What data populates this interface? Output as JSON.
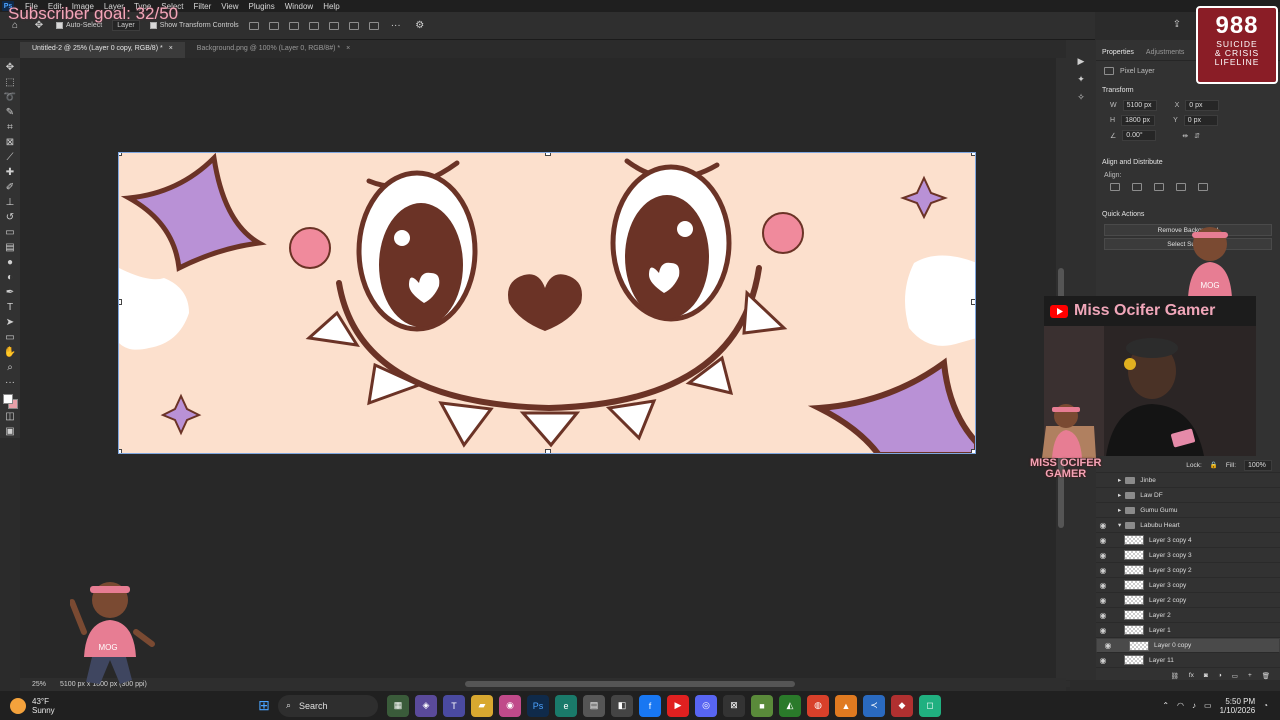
{
  "overlay": {
    "subscriber_goal": "Subscriber goal: 32/50",
    "hotline": {
      "number": "988",
      "line1": "SUICIDE",
      "line2": "& CRISIS",
      "line3": "LIFELINE"
    },
    "stream_title": "Miss Ocifer Gamer",
    "brand_line1": "MISS OCIFER",
    "brand_line2": "GAMER",
    "brand_badge": "MOG"
  },
  "menubar": {
    "app_icon": "Ps",
    "items": [
      "File",
      "Edit",
      "Image",
      "Layer",
      "Type",
      "Select",
      "Filter",
      "View",
      "Plugins",
      "Window",
      "Help"
    ]
  },
  "options": {
    "auto_select_label": "Auto-Select",
    "auto_select_value": "Layer",
    "transform_controls_label": "Show Transform Controls"
  },
  "tabs": [
    {
      "label": "Untitled-2 @ 25% (Layer 0 copy, RGB/8) *",
      "active": true
    },
    {
      "label": "Background.png @ 100% (Layer 0, RGB/8#) *",
      "active": false
    }
  ],
  "properties": {
    "tab_properties": "Properties",
    "tab_adjustments": "Adjustments",
    "layer_type": "Pixel Layer",
    "transform_title": "Transform",
    "w_label": "W",
    "w_value": "5100 px",
    "h_label": "H",
    "h_value": "1800 px",
    "x_label": "X",
    "x_value": "0 px",
    "y_label": "Y",
    "y_value": "0 px",
    "angle_value": "0.00°",
    "align_title": "Align and Distribute",
    "align_label": "Align:",
    "quick_actions_title": "Quick Actions",
    "remove_bg": "Remove Background",
    "select_subject": "Select Subject"
  },
  "layers_panel": {
    "lock_label": "Lock:",
    "fill_label": "Fill:",
    "fill_value": "100%",
    "items": [
      {
        "name": "Jinbe",
        "type": "folder"
      },
      {
        "name": "Law DF",
        "type": "folder"
      },
      {
        "name": "Gumu Gumu",
        "type": "folder"
      },
      {
        "name": "Labubu Heart",
        "type": "folder-open"
      },
      {
        "name": "Layer 3 copy 4",
        "type": "layer"
      },
      {
        "name": "Layer 3 copy 3",
        "type": "layer"
      },
      {
        "name": "Layer 3 copy 2",
        "type": "layer"
      },
      {
        "name": "Layer 3 copy",
        "type": "layer"
      },
      {
        "name": "Layer 2 copy",
        "type": "layer"
      },
      {
        "name": "Layer 2",
        "type": "layer"
      },
      {
        "name": "Layer 1",
        "type": "layer"
      },
      {
        "name": "Layer 0 copy",
        "type": "layer",
        "selected": true
      },
      {
        "name": "Layer 11",
        "type": "layer"
      }
    ]
  },
  "statusbar": {
    "zoom": "25%",
    "doc_info": "5100 px x 1800 px (300 ppi)"
  },
  "taskbar": {
    "weather_temp": "43°F",
    "weather_desc": "Sunny",
    "search_label": "Search",
    "time": "5:50 PM",
    "date": "1/10/2026"
  },
  "colors": {
    "canvas_bg": "#fce0cd",
    "eye_brown": "#6b3326",
    "cheek_pink": "#f08a9c",
    "star_purple": "#b991d6",
    "overlay_pink": "#f3a6b9",
    "hotline_red": "#8a1d26"
  }
}
